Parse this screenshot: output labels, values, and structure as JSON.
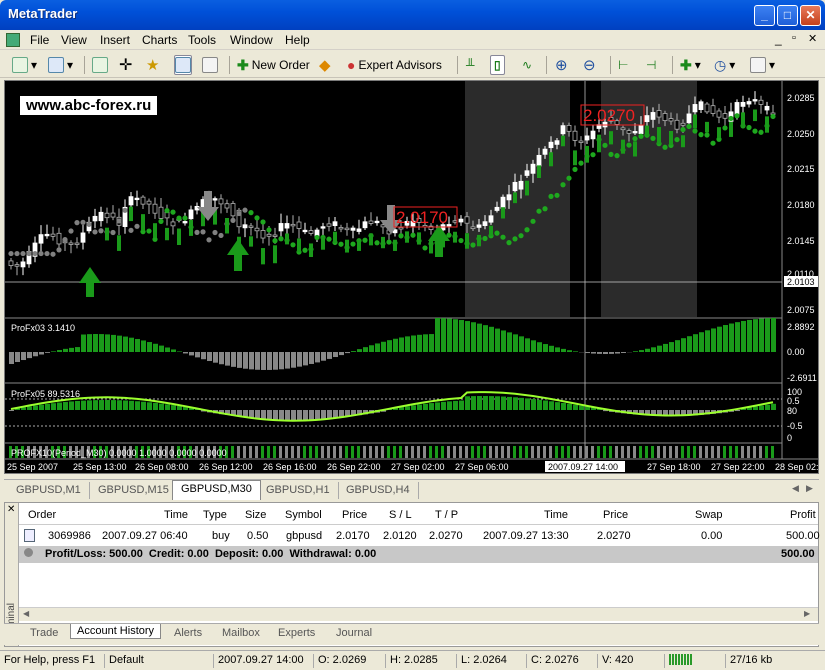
{
  "window": {
    "title": "MetaTrader",
    "min": "_",
    "max": "□",
    "close": "✕"
  },
  "menu": [
    "File",
    "View",
    "Insert",
    "Charts",
    "Tools",
    "Window",
    "Help"
  ],
  "toolbar": {
    "new_order": "New Order",
    "expert_advisors": "Expert Advisors"
  },
  "chart": {
    "site_label": "www.abc-forex.ru",
    "price_scale": [
      "2.0285",
      "2.0250",
      "2.0215",
      "2.0180",
      "2.0145",
      "2.0110",
      "2.0075"
    ],
    "current_price": "2.0103",
    "annotation_1": "2.0170",
    "annotation_2": "2.0270",
    "indicator_1_name": "ProFx03 3.1410",
    "indicator_1_scale": [
      "2.8892",
      "0.00",
      "-2.6911"
    ],
    "indicator_2_name": "ProFx05 89.5316",
    "indicator_2_scale": [
      "100",
      "0.5",
      "80",
      "-0.5",
      "0"
    ],
    "indicator_3_name": "PROFX10(Period_M30) 0.0000 1.0000 0.0000 0.0000",
    "time_axis": [
      "25 Sep 2007",
      "25 Sep 13:00",
      "26 Sep 08:00",
      "26 Sep 12:00",
      "26 Sep 16:00",
      "26 Sep 22:00",
      "27 Sep 02:00",
      "27 Sep 06:00",
      "2007.09.27 14:00",
      "27 Sep 18:00",
      "27 Sep 22:00",
      "28 Sep 02:00"
    ]
  },
  "chart_tabs": [
    "GBPUSD,M1",
    "GBPUSD,M15",
    "GBPUSD,M30",
    "GBPUSD,H1",
    "GBPUSD,H4"
  ],
  "terminal": {
    "side_label": "Terminal",
    "headers": [
      "Order",
      "Time",
      "Type",
      "Size",
      "Symbol",
      "Price",
      "S / L",
      "T / P",
      "Time",
      "Price",
      "Swap",
      "Profit"
    ],
    "row": [
      "3069986",
      "2007.09.27 06:40",
      "buy",
      "0.50",
      "gbpusd",
      "2.0170",
      "2.0120",
      "2.0270",
      "2007.09.27 13:30",
      "2.0270",
      "0.00",
      "500.00"
    ],
    "summary": "Profit/Loss: 500.00  Credit: 0.00  Deposit: 0.00  Withdrawal: 0.00",
    "summary_total": "500.00",
    "tabs": [
      "Trade",
      "Account History",
      "Alerts",
      "Mailbox",
      "Experts",
      "Journal"
    ]
  },
  "status": {
    "help": "For Help, press F1",
    "profile": "Default",
    "datetime": "2007.09.27 14:00",
    "open": "O: 2.0269",
    "high": "H: 2.0285",
    "low": "L: 2.0264",
    "close": "C: 2.0276",
    "volume": "V: 420",
    "traffic": "27/16 kb"
  }
}
